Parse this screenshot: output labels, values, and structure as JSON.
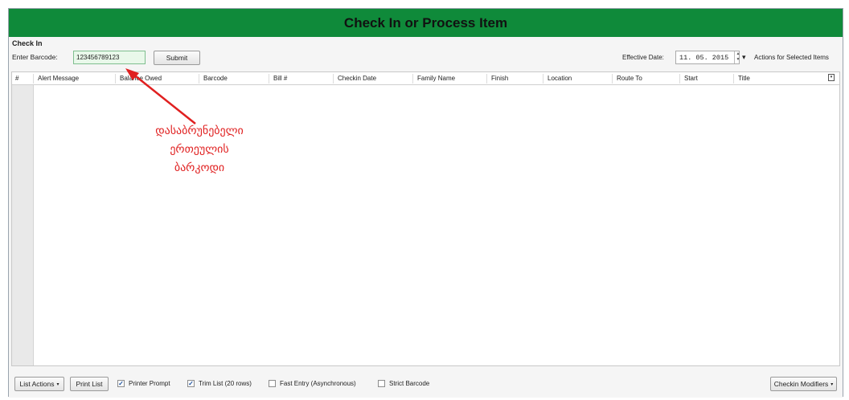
{
  "window": {
    "title": "Check In or Process Item"
  },
  "checkin": {
    "section_label": "Check In",
    "barcode_label": "Enter Barcode:",
    "barcode_value": "123456789123",
    "submit_label": "Submit"
  },
  "effective": {
    "label": "Effective Date:",
    "date_value": "11. 05. 2015",
    "actions_label": "Actions for Selected Items"
  },
  "grid": {
    "columns": [
      "#",
      "Alert Message",
      "Balance Owed",
      "Barcode",
      "Bill #",
      "Checkin Date",
      "Family Name",
      "Finish",
      "Location",
      "Route To",
      "Start",
      "Title"
    ],
    "rows": []
  },
  "annotation": {
    "lines": [
      "დასაბრუნებელი",
      "ერთეულის",
      "ბარკოდი"
    ],
    "color": "#e02020"
  },
  "footer": {
    "list_actions": "List Actions",
    "print_list": "Print List",
    "checkboxes": [
      {
        "label": "Printer Prompt",
        "checked": true
      },
      {
        "label": "Trim List (20 rows)",
        "checked": true
      },
      {
        "label": "Fast Entry (Asynchronous)",
        "checked": false
      },
      {
        "label": "Strict Barcode",
        "checked": false
      }
    ],
    "checkin_modifiers": "Checkin Modifiers"
  },
  "colors": {
    "title_bar": "#0f8a3a",
    "annotation": "#e02020"
  }
}
